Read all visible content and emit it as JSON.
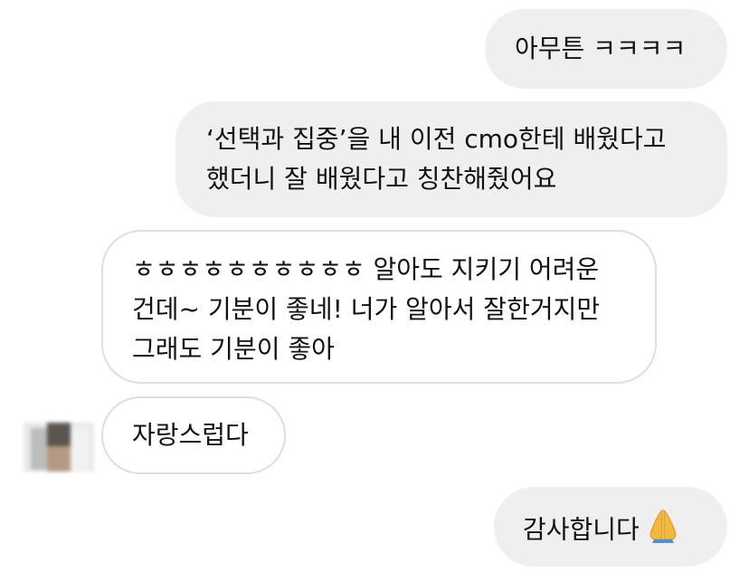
{
  "messages": [
    {
      "id": "m1",
      "side": "sent",
      "lines": [
        "아무튼 ㅋㅋㅋㅋ"
      ]
    },
    {
      "id": "m2",
      "side": "sent",
      "lines": [
        "‘선택과 집중’을 내 이전 cmo한테 배웠다고",
        "했더니 잘 배웠다고 칭찬해줬어요"
      ]
    },
    {
      "id": "m3",
      "side": "received",
      "lines": [
        "ㅎㅎㅎㅎㅎㅎㅎㅎㅎㅎ 알아도 지키기 어려운",
        "건데~ 기분이 좋네! 너가 알아서 잘한거지만",
        "그래도 기분이 좋아"
      ]
    },
    {
      "id": "m4",
      "side": "received",
      "lines": [
        "자랑스럽다"
      ]
    },
    {
      "id": "m5",
      "side": "sent",
      "lines": [
        "감사합니다"
      ],
      "emoji": "folded-hands-icon"
    }
  ],
  "colors": {
    "sent_bubble": "#efefef",
    "received_border": "#dedede",
    "text": "#111111",
    "emoji_skin": "#f5b93a"
  }
}
